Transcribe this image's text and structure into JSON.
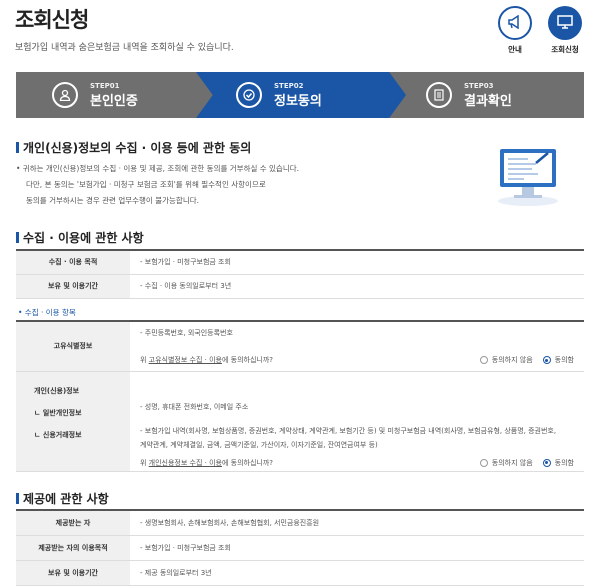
{
  "header": {
    "title": "조회신청",
    "subtitle": "보험가입 내역과 숨은보험금 내역을 조회하실 수 있습니다.",
    "guide_label": "안내",
    "request_label": "조회신청"
  },
  "steps": [
    {
      "num": "STEP01",
      "label": "본인인증",
      "icon": "person-icon"
    },
    {
      "num": "STEP02",
      "label": "정보동의",
      "icon": "check-icon"
    },
    {
      "num": "STEP03",
      "label": "결과확인",
      "icon": "document-icon"
    }
  ],
  "consent": {
    "heading": "개인(신용)정보의 수집 · 이용 등에 관한 동의",
    "lines": [
      "• 귀하는 개인(신용)정보의 수집 · 이용 및 제공, 조회에 관한 동의를 거부하실 수 있습니다.",
      "다만, 본 동의는 '보험가입 · 미청구 보험금 조회'를 위해 필수적인 사항이므로",
      "동의를 거부하시는 경우 관련 업무수행이 불가능합니다."
    ]
  },
  "collect": {
    "heading": "수집 · 이용에 관한 사항",
    "rows": [
      {
        "th": "수집 · 이용 목적",
        "td": "- 보험가입 · 미청구보험금 조회"
      },
      {
        "th": "보유 및 이용기간",
        "td": "- 수집 · 이용 동의일로부터 3년"
      }
    ],
    "items_label": "• 수집 · 이용 항목",
    "unique": {
      "th": "고유식별정보",
      "value": "- 주민등록번호, 외국인등록번호",
      "question": "위 고유식별정보 수집 · 이용에 동의하십니까?",
      "question_link": "고유식별정보 수집 · 이용"
    },
    "personal": {
      "th": "개인(신용)정보",
      "general_label": "ㄴ 일반개인정보",
      "credit_label": "ㄴ 신용거래정보",
      "general_value": "- 성명, 휴대폰 전화번호, 이메일 주소",
      "credit_value_1": "- 보험가입 내역(회사명, 보험상품명, 증권번호, 계약상태, 계약관계, 보험기간 등) 및 미청구보험금 내역(회사명, 보험금유형, 상품명, 증권번호,",
      "credit_value_2": "계약관계, 계약체결일, 금액, 금액기준일, 가산이자, 이자기준일, 잔여연금여부 등)",
      "question": "위 개인신용정보 수집 · 이용에 동의하십니까?",
      "question_link": "개인신용정보 수집 · 이용"
    },
    "disagree": "동의하지 않음",
    "agree": "동의함"
  },
  "provide": {
    "heading": "제공에 관한 사항",
    "rows": [
      {
        "th": "제공받는 자",
        "td": "- 생명보험회사, 손해보험회사, 손해보험협회, 서민금융진흥원"
      },
      {
        "th": "제공받는 자의 이용목적",
        "td": "- 보험가입 · 미청구보험금 조회"
      },
      {
        "th": "보유 및 이용기간",
        "td": "- 제공 동의일로부터 3년"
      }
    ]
  }
}
